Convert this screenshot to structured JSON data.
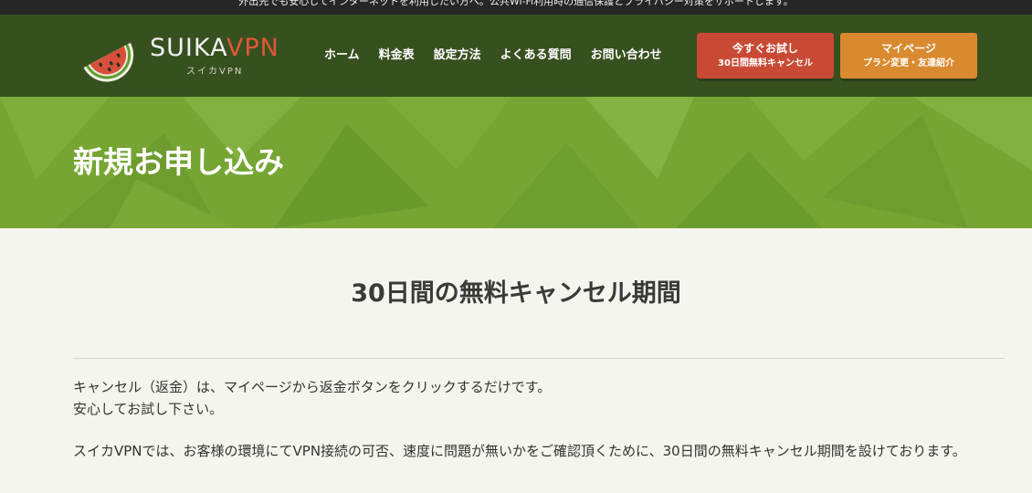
{
  "topbar": {
    "message": "外出先でも安心してインターネットを利用したい方へ。公共Wi-Fi利用時の通信保護とプライバシー対策をサポートします。"
  },
  "header": {
    "logo": {
      "brand_white": "SUIKA",
      "brand_accent": "VPN",
      "subtitle": "スイカVPN",
      "icon": "watermelon-icon"
    },
    "nav": [
      {
        "label": "ホーム"
      },
      {
        "label": "料金表"
      },
      {
        "label": "設定方法"
      },
      {
        "label": "よくある質問"
      },
      {
        "label": "お問い合わせ"
      }
    ],
    "trial_button": {
      "line1": "今すぐお試し",
      "line2": "30日間無料キャンセル"
    },
    "mypage_button": {
      "line1": "マイページ",
      "line2": "プラン変更・友達紹介"
    }
  },
  "hero": {
    "title": "新規お申し込み"
  },
  "content": {
    "section_title": "30日間の無料キャンセル期間",
    "paragraph1_line1": "キャンセル（返金）は、マイページから返金ボタンをクリックするだけです。",
    "paragraph1_line2": "安心してお試し下さい。",
    "paragraph2": "スイカVPNでは、お客様の環境にてVPN接続の可否、速度に問題が無いかをご確認頂くために、30日間の無料キャンセル期間を設けております。"
  },
  "colors": {
    "topbar": "#262626",
    "header": "#37501f",
    "hero": "#76a533",
    "trial_button": "#c84a34",
    "mypage_button": "#d98a2f",
    "logo_accent": "#e0573a",
    "background": "#f5f5ef"
  }
}
